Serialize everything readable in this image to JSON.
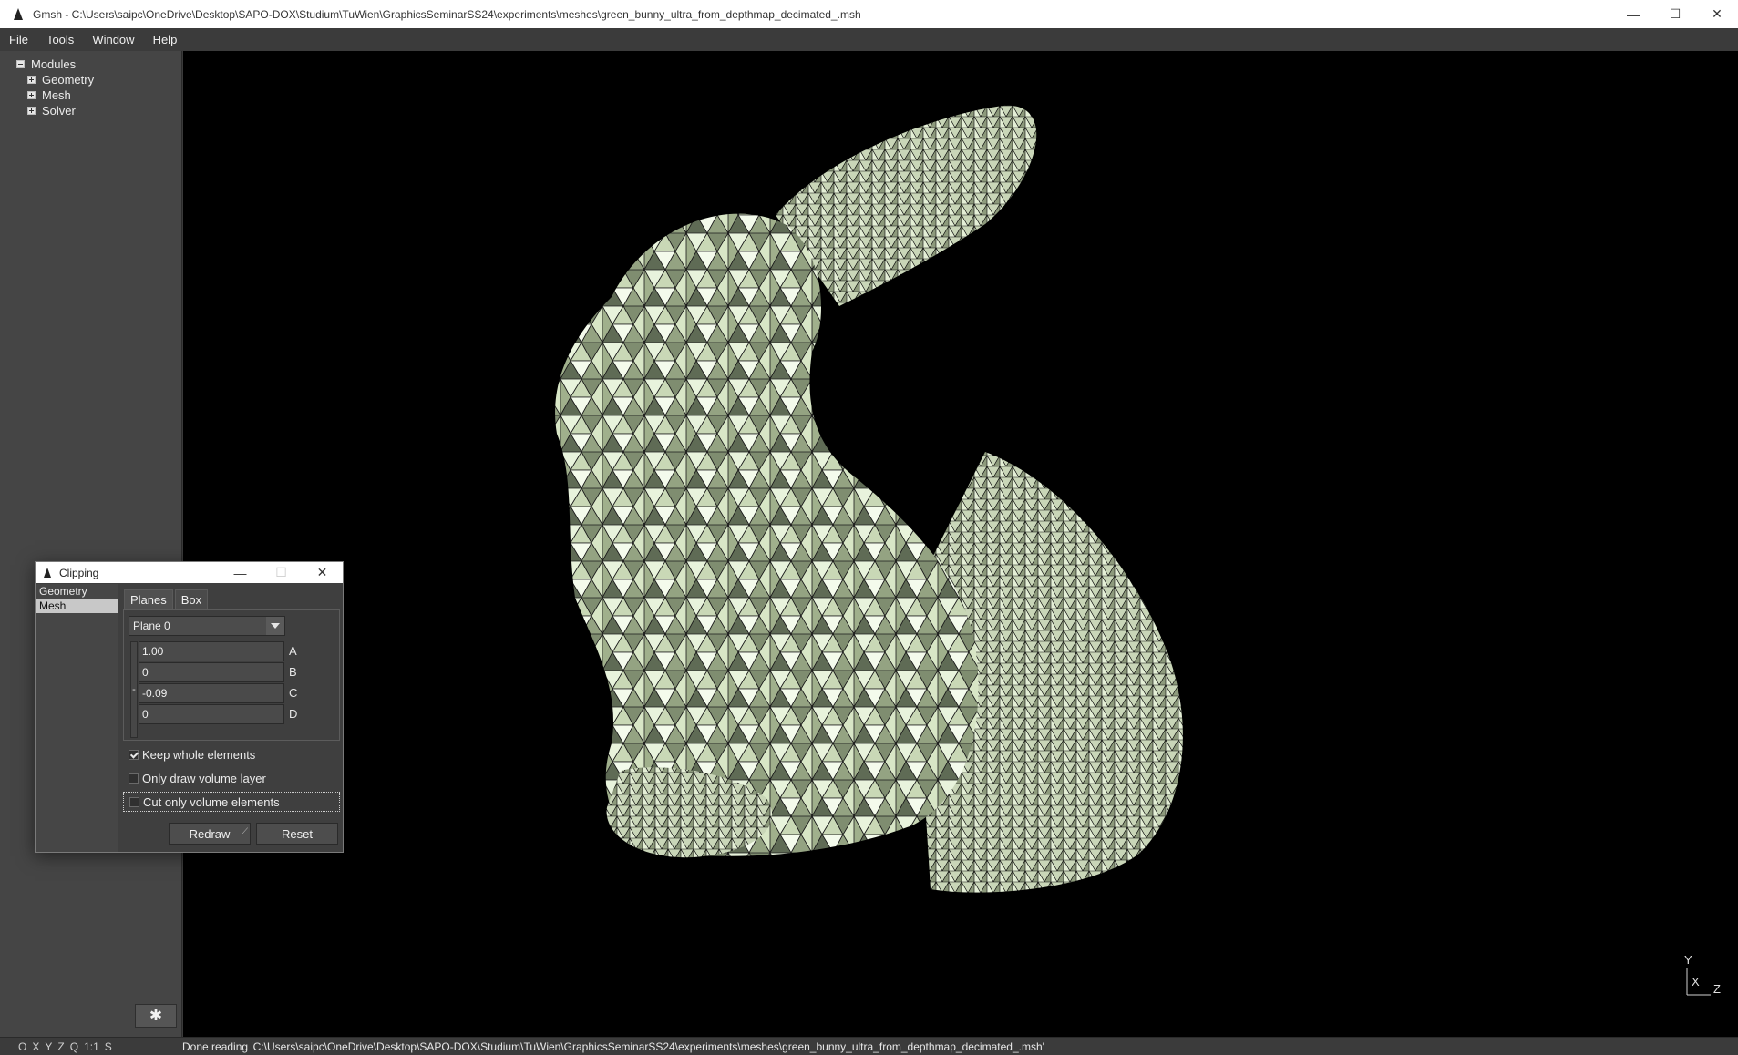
{
  "window": {
    "title": "Gmsh - C:\\Users\\saipc\\OneDrive\\Desktop\\SAPO-DOX\\Studium\\TuWien\\GraphicsSeminarSS24\\experiments\\meshes\\green_bunny_ultra_from_depthmap_decimated_.msh",
    "minimize": "—",
    "maximize": "☐",
    "close": "✕"
  },
  "menu": [
    {
      "label": "File"
    },
    {
      "label": "Tools"
    },
    {
      "label": "Window"
    },
    {
      "label": "Help"
    }
  ],
  "tree": {
    "root": "Modules",
    "items": [
      {
        "label": "Geometry"
      },
      {
        "label": "Mesh"
      },
      {
        "label": "Solver"
      }
    ]
  },
  "settings_icon": "gear-icon",
  "gear_glyph": "✱",
  "axes": {
    "y": "Y",
    "x": "X",
    "z": "Z"
  },
  "status": {
    "nav": [
      "O",
      "X",
      "Y",
      "Z",
      "Q",
      "1:1",
      "S"
    ],
    "message": "Done reading 'C:\\Users\\saipc\\OneDrive\\Desktop\\SAPO-DOX\\Studium\\TuWien\\GraphicsSeminarSS24\\experiments\\meshes\\green_bunny_ultra_from_depthmap_decimated_.msh'"
  },
  "clipping": {
    "title": "Clipping",
    "minimize": "—",
    "maximize": "☐",
    "close": "✕",
    "list": [
      {
        "label": "Geometry",
        "selected": false
      },
      {
        "label": "Mesh",
        "selected": true
      }
    ],
    "tabs": [
      {
        "label": "Planes",
        "active": true
      },
      {
        "label": "Box",
        "active": false
      }
    ],
    "plane_select": "Plane 0",
    "minus": "-",
    "fields": [
      {
        "value": "1.00",
        "label": "A"
      },
      {
        "value": "0",
        "label": "B"
      },
      {
        "value": "-0.09",
        "label": "C"
      },
      {
        "value": "0",
        "label": "D"
      }
    ],
    "options": [
      {
        "label": "Keep whole elements",
        "checked": true
      },
      {
        "label": "Only draw volume layer",
        "checked": false
      },
      {
        "label": "Cut only volume elements",
        "checked": false
      }
    ],
    "redraw": "Redraw",
    "reset": "Reset"
  },
  "colors": {
    "mesh_light": "#e4efd6",
    "mesh_mid": "#a6b593",
    "mesh_dark": "#5f6b55",
    "background": "#000000"
  }
}
